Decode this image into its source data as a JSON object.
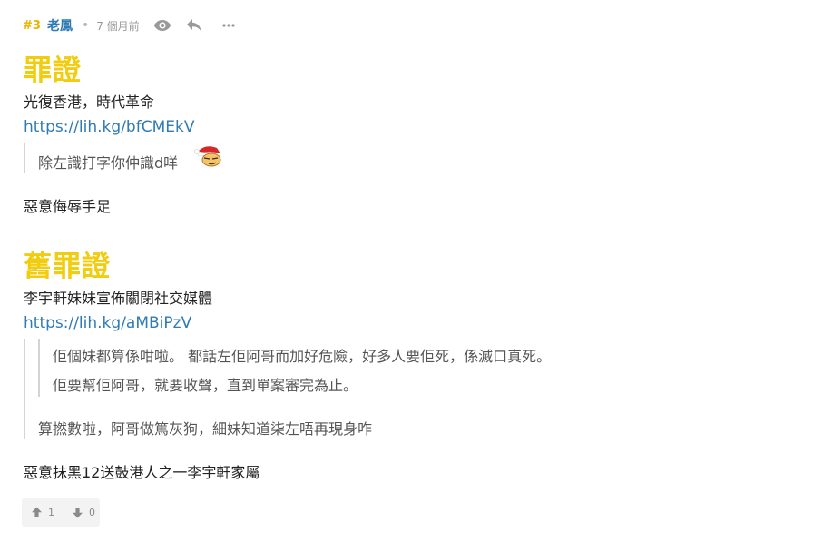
{
  "post": {
    "floor": "#3",
    "author": "老鳳",
    "separator": "•",
    "time": "7 個月前",
    "icons": [
      "eye-icon",
      "reply-icon",
      "more-icon"
    ]
  },
  "section1": {
    "heading": "罪證",
    "title": "光復香港，時代革命",
    "link": "https://lih.kg/bfCMEkV",
    "quote": "除左識打字你仲識d咩",
    "verdict": "惡意侮辱手足"
  },
  "section2": {
    "heading": "舊罪證",
    "title": "李宇軒妹妹宣佈關閉社交媒體",
    "link": "https://lih.kg/aMBiPzV",
    "nested_quote": [
      "佢個妹都算係咁啦。 都話左佢阿哥而加好危險，好多人要佢死，係滅口真死。",
      "佢要幫佢阿哥，就要收聲，直到單案審完為止。"
    ],
    "quote": "算撚數啦，阿哥做篤灰狗，細妹知道柒左唔再現身咋",
    "verdict": "惡意抹黑12送鼓港人之一李宇軒家屬"
  },
  "votes": {
    "up": "1",
    "down": "0"
  },
  "colors": {
    "accent": "#f2cc0f",
    "link": "#2f7bb5",
    "floor": "#e9b400"
  }
}
